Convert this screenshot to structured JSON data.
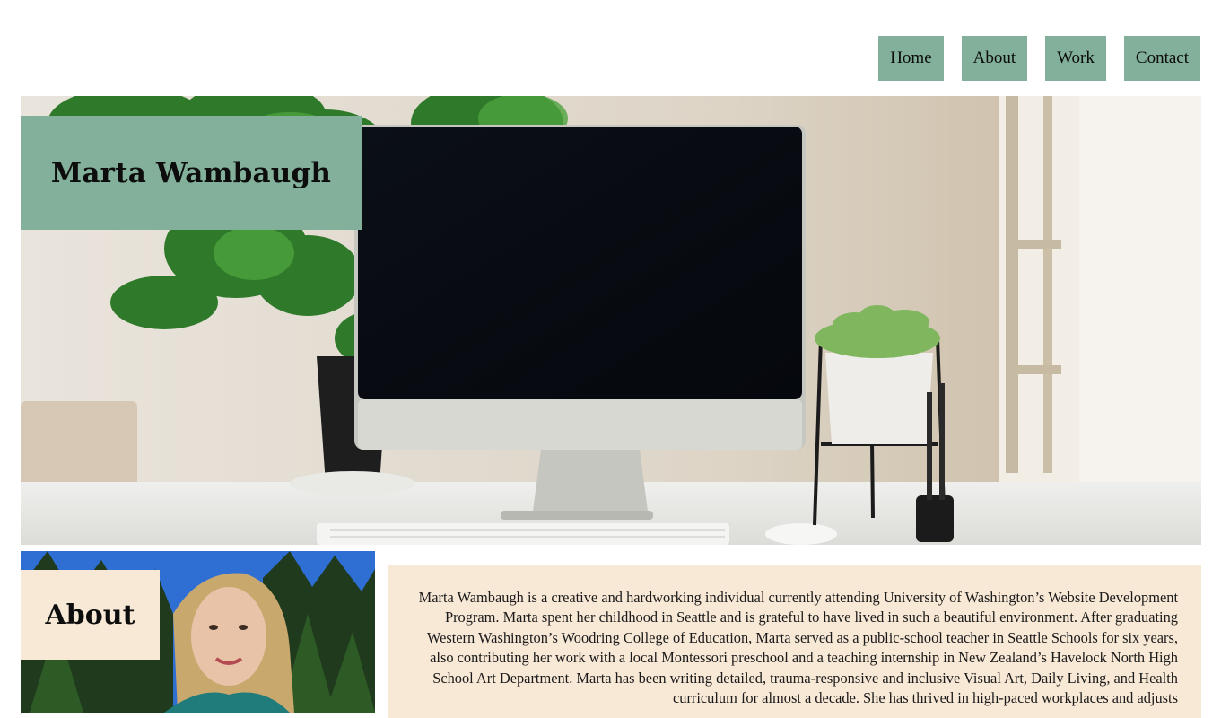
{
  "nav": {
    "items": [
      {
        "label": "Home"
      },
      {
        "label": "About"
      },
      {
        "label": "Work"
      },
      {
        "label": "Contact"
      }
    ]
  },
  "hero": {
    "title": "Marta Wambaugh"
  },
  "about": {
    "heading": "About",
    "body": "Marta Wambaugh is a creative and hardworking individual currently attending University of Washington’s Website Development Program. Marta spent her childhood in Seattle and is grateful to have lived in such a beautiful environment. After graduating Western Washington’s Woodring College of Education, Marta served as a public-school teacher in Seattle Schools for six years, also contributing her work with a local Montessori preschool and a teaching internship in New Zealand’s Havelock North High School Art Department. Marta has been writing detailed, trauma-responsive and inclusive Visual Art, Daily Living, and Health curriculum for almost a decade. She has thrived in high-paced workplaces and adjusts"
  },
  "colors": {
    "accent_green": "#82b09a",
    "accent_cream": "#f8e8d6"
  }
}
